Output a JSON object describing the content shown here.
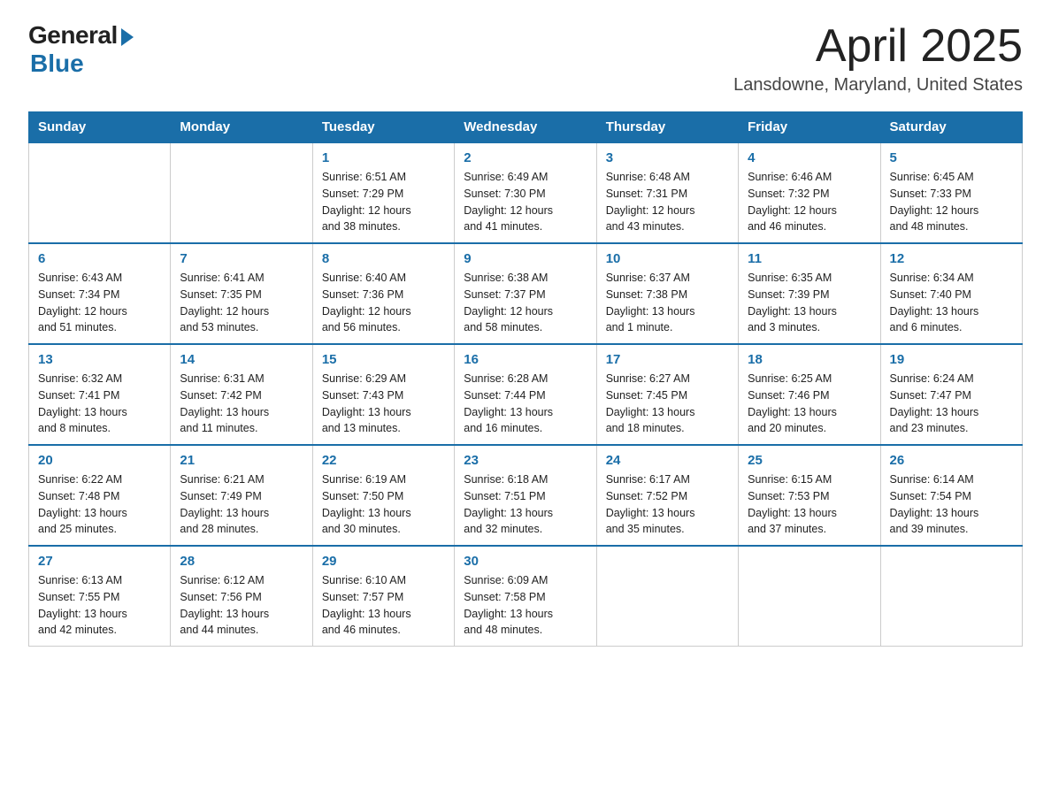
{
  "logo": {
    "general": "General",
    "blue": "Blue"
  },
  "header": {
    "month": "April 2025",
    "location": "Lansdowne, Maryland, United States"
  },
  "weekdays": [
    "Sunday",
    "Monday",
    "Tuesday",
    "Wednesday",
    "Thursday",
    "Friday",
    "Saturday"
  ],
  "weeks": [
    [
      {
        "day": "",
        "info": ""
      },
      {
        "day": "",
        "info": ""
      },
      {
        "day": "1",
        "info": "Sunrise: 6:51 AM\nSunset: 7:29 PM\nDaylight: 12 hours\nand 38 minutes."
      },
      {
        "day": "2",
        "info": "Sunrise: 6:49 AM\nSunset: 7:30 PM\nDaylight: 12 hours\nand 41 minutes."
      },
      {
        "day": "3",
        "info": "Sunrise: 6:48 AM\nSunset: 7:31 PM\nDaylight: 12 hours\nand 43 minutes."
      },
      {
        "day": "4",
        "info": "Sunrise: 6:46 AM\nSunset: 7:32 PM\nDaylight: 12 hours\nand 46 minutes."
      },
      {
        "day": "5",
        "info": "Sunrise: 6:45 AM\nSunset: 7:33 PM\nDaylight: 12 hours\nand 48 minutes."
      }
    ],
    [
      {
        "day": "6",
        "info": "Sunrise: 6:43 AM\nSunset: 7:34 PM\nDaylight: 12 hours\nand 51 minutes."
      },
      {
        "day": "7",
        "info": "Sunrise: 6:41 AM\nSunset: 7:35 PM\nDaylight: 12 hours\nand 53 minutes."
      },
      {
        "day": "8",
        "info": "Sunrise: 6:40 AM\nSunset: 7:36 PM\nDaylight: 12 hours\nand 56 minutes."
      },
      {
        "day": "9",
        "info": "Sunrise: 6:38 AM\nSunset: 7:37 PM\nDaylight: 12 hours\nand 58 minutes."
      },
      {
        "day": "10",
        "info": "Sunrise: 6:37 AM\nSunset: 7:38 PM\nDaylight: 13 hours\nand 1 minute."
      },
      {
        "day": "11",
        "info": "Sunrise: 6:35 AM\nSunset: 7:39 PM\nDaylight: 13 hours\nand 3 minutes."
      },
      {
        "day": "12",
        "info": "Sunrise: 6:34 AM\nSunset: 7:40 PM\nDaylight: 13 hours\nand 6 minutes."
      }
    ],
    [
      {
        "day": "13",
        "info": "Sunrise: 6:32 AM\nSunset: 7:41 PM\nDaylight: 13 hours\nand 8 minutes."
      },
      {
        "day": "14",
        "info": "Sunrise: 6:31 AM\nSunset: 7:42 PM\nDaylight: 13 hours\nand 11 minutes."
      },
      {
        "day": "15",
        "info": "Sunrise: 6:29 AM\nSunset: 7:43 PM\nDaylight: 13 hours\nand 13 minutes."
      },
      {
        "day": "16",
        "info": "Sunrise: 6:28 AM\nSunset: 7:44 PM\nDaylight: 13 hours\nand 16 minutes."
      },
      {
        "day": "17",
        "info": "Sunrise: 6:27 AM\nSunset: 7:45 PM\nDaylight: 13 hours\nand 18 minutes."
      },
      {
        "day": "18",
        "info": "Sunrise: 6:25 AM\nSunset: 7:46 PM\nDaylight: 13 hours\nand 20 minutes."
      },
      {
        "day": "19",
        "info": "Sunrise: 6:24 AM\nSunset: 7:47 PM\nDaylight: 13 hours\nand 23 minutes."
      }
    ],
    [
      {
        "day": "20",
        "info": "Sunrise: 6:22 AM\nSunset: 7:48 PM\nDaylight: 13 hours\nand 25 minutes."
      },
      {
        "day": "21",
        "info": "Sunrise: 6:21 AM\nSunset: 7:49 PM\nDaylight: 13 hours\nand 28 minutes."
      },
      {
        "day": "22",
        "info": "Sunrise: 6:19 AM\nSunset: 7:50 PM\nDaylight: 13 hours\nand 30 minutes."
      },
      {
        "day": "23",
        "info": "Sunrise: 6:18 AM\nSunset: 7:51 PM\nDaylight: 13 hours\nand 32 minutes."
      },
      {
        "day": "24",
        "info": "Sunrise: 6:17 AM\nSunset: 7:52 PM\nDaylight: 13 hours\nand 35 minutes."
      },
      {
        "day": "25",
        "info": "Sunrise: 6:15 AM\nSunset: 7:53 PM\nDaylight: 13 hours\nand 37 minutes."
      },
      {
        "day": "26",
        "info": "Sunrise: 6:14 AM\nSunset: 7:54 PM\nDaylight: 13 hours\nand 39 minutes."
      }
    ],
    [
      {
        "day": "27",
        "info": "Sunrise: 6:13 AM\nSunset: 7:55 PM\nDaylight: 13 hours\nand 42 minutes."
      },
      {
        "day": "28",
        "info": "Sunrise: 6:12 AM\nSunset: 7:56 PM\nDaylight: 13 hours\nand 44 minutes."
      },
      {
        "day": "29",
        "info": "Sunrise: 6:10 AM\nSunset: 7:57 PM\nDaylight: 13 hours\nand 46 minutes."
      },
      {
        "day": "30",
        "info": "Sunrise: 6:09 AM\nSunset: 7:58 PM\nDaylight: 13 hours\nand 48 minutes."
      },
      {
        "day": "",
        "info": ""
      },
      {
        "day": "",
        "info": ""
      },
      {
        "day": "",
        "info": ""
      }
    ]
  ]
}
